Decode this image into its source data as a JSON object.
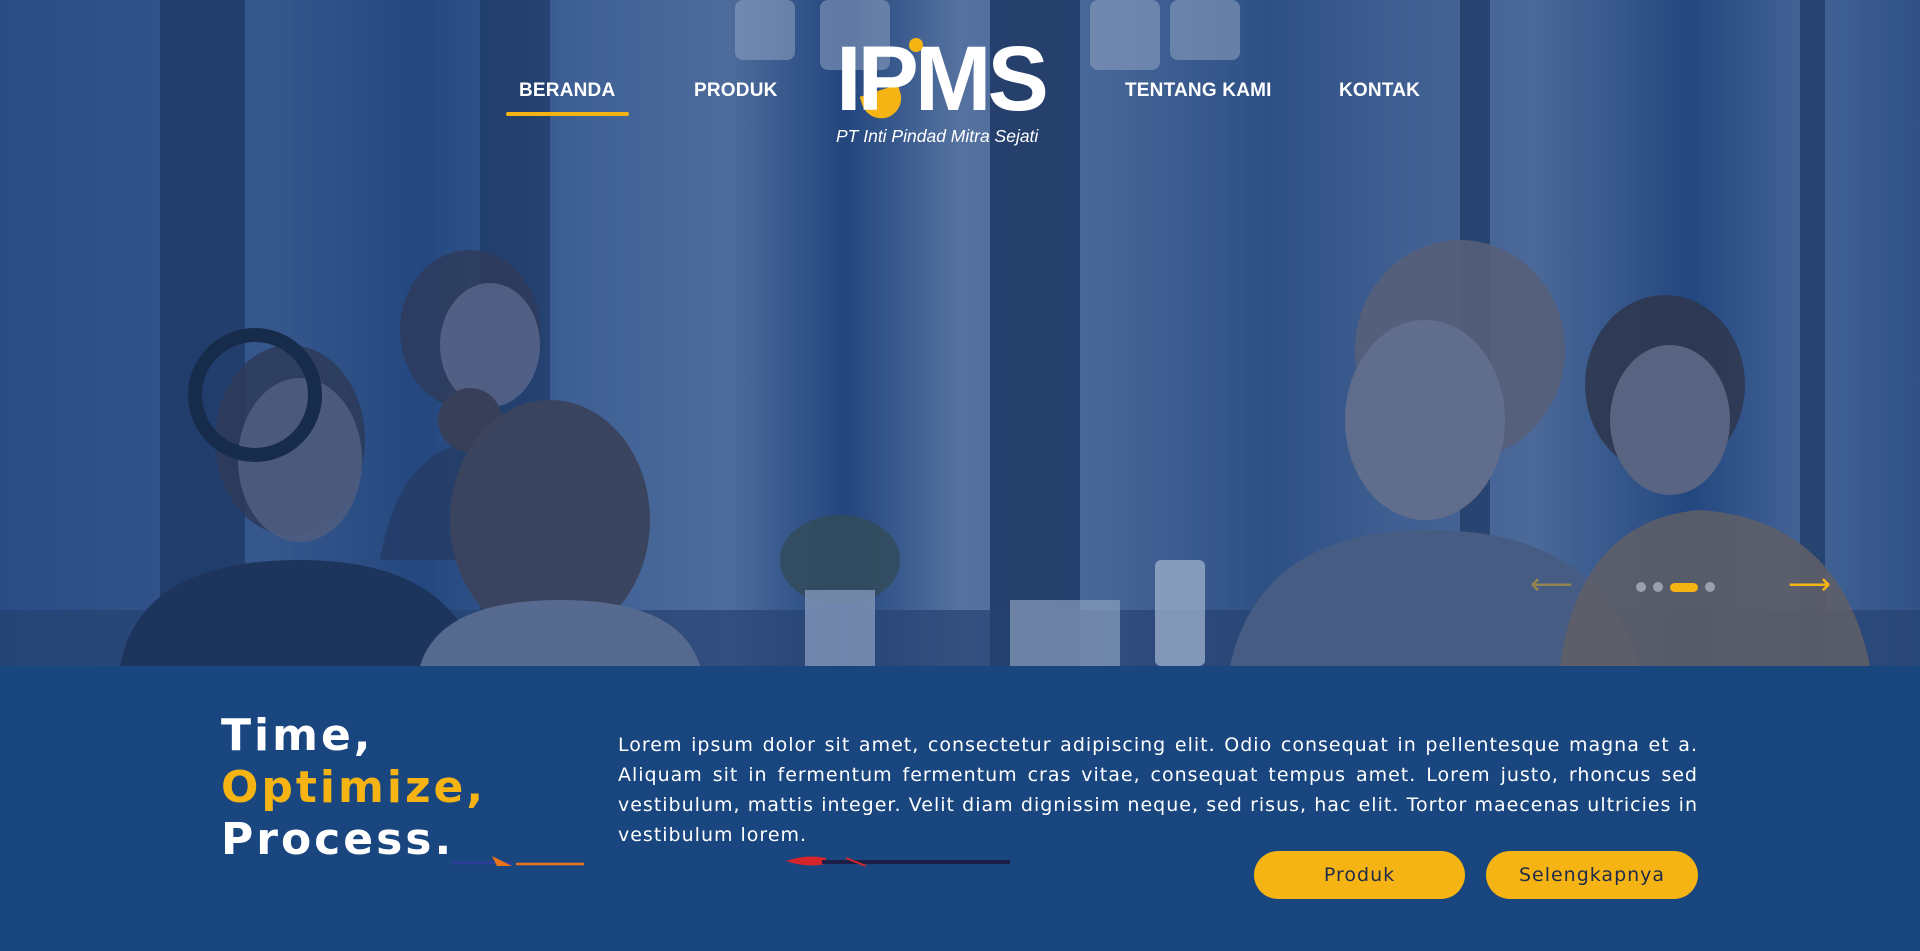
{
  "nav": {
    "items": [
      {
        "label": "BERANDA",
        "active": true
      },
      {
        "label": "PRODUK",
        "active": false
      },
      {
        "label": "TENTANG KAMI",
        "active": false
      },
      {
        "label": "KONTAK",
        "active": false
      }
    ],
    "active_color": "#f5b414"
  },
  "logo": {
    "mark": "IPMS",
    "tagline": "PT Inti Pindad Mitra Sejati"
  },
  "slider": {
    "prev_icon": "arrow-left-icon",
    "next_icon": "arrow-right-icon",
    "slide_count": 4,
    "active_index": 2
  },
  "hero": {
    "image": "photo of people working at a shared table in an office"
  },
  "headline": {
    "line1": "Time,",
    "line2": "Optimize,",
    "line3": "Process."
  },
  "body_text": "Lorem ipsum dolor sit amet, consectetur adipiscing elit. Odio consequat in pellentesque magna et a. Aliquam sit in fermentum fermentum cras vitae, consequat tempus amet. Lorem justo, rhoncus sed vestibulum, mattis integer. Velit diam dignissim neque, sed risus, hac elit. Tortor maecenas ultricies in vestibulum lorem.",
  "buttons": {
    "primary": "Produk",
    "secondary": "Selengkapnya"
  },
  "colors": {
    "brand_blue": "#19467f",
    "accent_yellow": "#f5b414",
    "text_white": "#ffffff"
  }
}
